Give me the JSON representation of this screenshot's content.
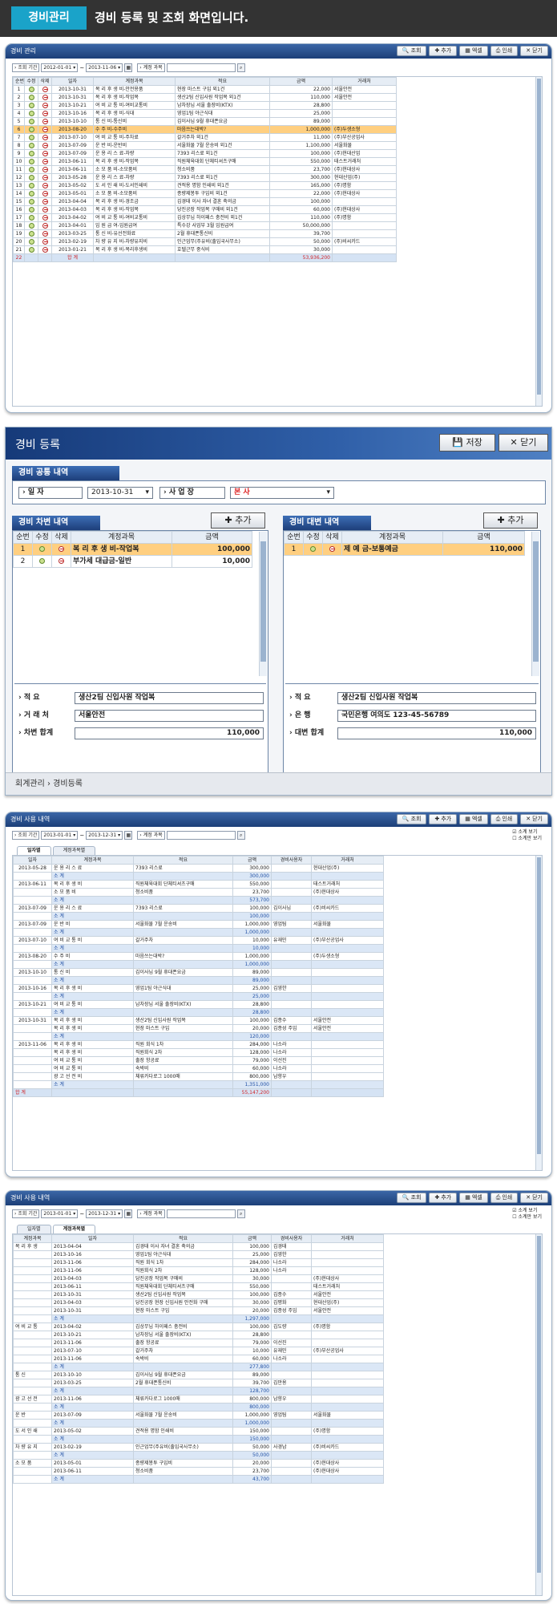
{
  "header": {
    "tag": "경비관리",
    "title": "경비 등록 및 조회 화면입니다."
  },
  "toolbar": {
    "search": "조회",
    "add": "추가",
    "excel": "엑셀",
    "print": "인쇄",
    "close": "닫기"
  },
  "filters": {
    "period_label": "조회 기간",
    "account_label": "계정 과목",
    "from": "2012-01-01",
    "to": "2013-11-06",
    "from2": "2013-01-01",
    "to2": "2013-12-31"
  },
  "panel1": {
    "title": "경비 관리",
    "columns": [
      "순번",
      "수정",
      "삭제",
      "일자",
      "계정과목",
      "적요",
      "금액",
      "거래처"
    ],
    "rows": [
      [
        "1",
        "2013-10-31",
        "복 리 후 생 비-안전용품",
        "현장 마스트 구입 외1건",
        "22,000",
        "서울안전"
      ],
      [
        "2",
        "2013-10-31",
        "복 리 후 생 비-작업복",
        "생산2팀 신입사원 작업복 외1건",
        "110,000",
        "서울안전"
      ],
      [
        "3",
        "2013-10-21",
        "여 비 교 통 비-여비교통비",
        "남차장님 서울 출장비(KTX)",
        "28,800",
        ""
      ],
      [
        "4",
        "2013-10-16",
        "복 리 후 생 비-식대",
        "영업1팀 야근식대",
        "25,000",
        ""
      ],
      [
        "5",
        "2013-10-10",
        "통 신 비-통신비",
        "김이사님 9월 휴대폰요금",
        "89,000",
        ""
      ],
      [
        "6",
        "2013-08-20",
        "수 주 비-수주비",
        "마음쓰는대박?",
        "1,000,000",
        "(주)두생소형"
      ],
      [
        "7",
        "2013-07-10",
        "여 비 교 통 비-주차료",
        "갈거주차 외1건",
        "11,000",
        "(주)부산공업사"
      ],
      [
        "8",
        "2013-07-09",
        "운 반 비-운반비",
        "서울화물 7월 운송비 외1건",
        "1,100,000",
        "서울화물"
      ],
      [
        "9",
        "2013-07-09",
        "운 용 리 스 료-차량",
        "7393 리스료 외1건",
        "100,000",
        "(주)현대산업"
      ],
      [
        "10",
        "2013-06-11",
        "복 리 후 생 비-작업복",
        "직원체육대회 단체티셔츠구매",
        "550,000",
        "태스트거래처"
      ],
      [
        "11",
        "2013-06-11",
        "소 모 품 비-소모품비",
        "청소비품",
        "23,700",
        "(주)현대상사"
      ],
      [
        "12",
        "2013-05-28",
        "운 용 리 스 료-차량",
        "7393 리스료 외1건",
        "300,000",
        "현대산업(주)"
      ],
      [
        "13",
        "2013-05-02",
        "도 서 인 쇄 비-도서인쇄비",
        "견적용 명함 인쇄비 외1건",
        "165,000",
        "(주)명함"
      ],
      [
        "14",
        "2013-05-01",
        "소 모 품 비-소모품비",
        "종량제봉투 구입비 외1건",
        "22,000",
        "(주)현대상사"
      ],
      [
        "15",
        "2013-04-04",
        "복 리 후 생 비-경조금",
        "김경태 이사 자녀 결혼 축의금",
        "100,000",
        ""
      ],
      [
        "16",
        "2013-04-03",
        "복 리 후 생 비-작업복",
        "당진공장 작업복 구매비 외1건",
        "60,000",
        "(주)현대상사"
      ],
      [
        "17",
        "2013-04-02",
        "여 비 교 통 비-여비교통비",
        "김상무님 하이패스 충전비 외1건",
        "110,000",
        "(주)명함"
      ],
      [
        "18",
        "2013-04-01",
        "임 원 급 여-임원급여",
        "특수강 사업부 3월 임원급여",
        "50,000,000",
        ""
      ],
      [
        "19",
        "2013-03-25",
        "통 신 비-유선전화료",
        "2월 휴대폰통신비",
        "39,700",
        ""
      ],
      [
        "20",
        "2013-02-19",
        "차 량 유 지 비-차량유지비",
        "인근업무(주유비(출입국사무소)",
        "50,000",
        "(주)비씨카드"
      ],
      [
        "21",
        "2013-01-21",
        "복 리 후 생 비-복리후생비",
        "호텔근무 중식비",
        "30,000",
        ""
      ]
    ],
    "total_no": "22",
    "total_label": "합 계",
    "total": "53,936,200"
  },
  "form": {
    "title": "경비 등록",
    "save": "저장",
    "close": "닫기",
    "common": "경비 공통 내역",
    "date_label": "일 자",
    "date": "2013-10-31",
    "site_label": "사 업 장",
    "site": "본 사",
    "debit_title": "경비 차변 내역",
    "credit_title": "경비 대변 내역",
    "add": "추가",
    "cols": [
      "순번",
      "수정",
      "삭제",
      "계정과목",
      "금액"
    ],
    "debit_rows": [
      [
        "1",
        "복 리 후 생 비-작업복",
        "100,000"
      ],
      [
        "2",
        "부가세 대급금-일반",
        "10,000"
      ]
    ],
    "credit_rows": [
      [
        "1",
        "제 예 금-보통예금",
        "110,000"
      ]
    ],
    "memo_label": "적 요",
    "memo": "생산2팀 신입사원 작업복",
    "vendor_label": "거 래 처",
    "vendor": "서울안전",
    "debit_sum_label": "차변 합계",
    "debit_sum": "110,000",
    "bank_label": "은 행",
    "bank": "국민은행 여의도 123-45-56789",
    "credit_sum_label": "대변 합계",
    "credit_sum": "110,000",
    "breadcrumb": [
      "회계관리",
      "경비등록"
    ]
  },
  "panel3": {
    "title": "경비 사용 내역",
    "tabs": [
      "일자별",
      "계정과목별"
    ],
    "chk1": "소계 보기",
    "chk2": "소계만 보기",
    "cols": [
      "일자",
      "계정과목",
      "적요",
      "금액",
      "경비사용자",
      "거래처"
    ],
    "rows": [
      [
        "2013-05-28",
        "운 용 리 스 료",
        "7393 리스료",
        "300,000",
        "",
        "현대산업(주)"
      ],
      [
        "",
        "소 계",
        "",
        "300,000",
        "",
        ""
      ],
      [
        "2013-06-11",
        "복 리 후 생 비",
        "직원체육대회 단체티셔츠구매",
        "550,000",
        "",
        "태스트거래처"
      ],
      [
        "",
        "소 모 품 비",
        "청소비품",
        "23,700",
        "",
        "(주)현대상사"
      ],
      [
        "",
        "소 계",
        "",
        "573,700",
        "",
        ""
      ],
      [
        "2013-07-09",
        "운 용 리 스 료",
        "7393 리스료",
        "100,000",
        "김이사님",
        "(주)비씨카드"
      ],
      [
        "",
        "소 계",
        "",
        "100,000",
        "",
        ""
      ],
      [
        "2013-07-09",
        "운 반 비",
        "서울화물 7월 운송비",
        "1,000,000",
        "영업팀",
        "서울화물"
      ],
      [
        "",
        "소 계",
        "",
        "1,000,000",
        "",
        ""
      ],
      [
        "2013-07-10",
        "여 비 교 통 비",
        "갈거주차",
        "10,000",
        "유재민",
        "(주)부산공업사"
      ],
      [
        "",
        "소 계",
        "",
        "10,000",
        "",
        ""
      ],
      [
        "2013-08-20",
        "수 주 비",
        "마음쓰는대박?",
        "1,000,000",
        "",
        "(주)두생소형"
      ],
      [
        "",
        "소 계",
        "",
        "1,000,000",
        "",
        ""
      ],
      [
        "2013-10-10",
        "통 신 비",
        "김이사님 9월 휴대폰요금",
        "89,000",
        "",
        ""
      ],
      [
        "",
        "소 계",
        "",
        "89,000",
        "",
        ""
      ],
      [
        "2013-10-16",
        "복 리 후 생 비",
        "영업1팀 야근식대",
        "25,000",
        "김영한",
        ""
      ],
      [
        "",
        "소 계",
        "",
        "25,000",
        "",
        ""
      ],
      [
        "2013-10-21",
        "여 비 교 통 비",
        "남차장님 서울 출장비(KTX)",
        "28,800",
        "",
        ""
      ],
      [
        "",
        "소 계",
        "",
        "28,800",
        "",
        ""
      ],
      [
        "2013-10-31",
        "복 리 후 생 비",
        "생산2팀 신입사원 작업복",
        "100,000",
        "김종수",
        "서울안전"
      ],
      [
        "",
        "복 리 후 생 비",
        "현장 마스트 구입",
        "20,000",
        "김종성 주임",
        "서울안전"
      ],
      [
        "",
        "소 계",
        "",
        "120,000",
        "",
        ""
      ],
      [
        "2013-11-06",
        "복 리 후 생 비",
        "직원 회식 1차",
        "284,000",
        "나소라",
        ""
      ],
      [
        "",
        "복 리 후 생 비",
        "직원회식 2차",
        "128,000",
        "나소라",
        ""
      ],
      [
        "",
        "여 비 교 통 비",
        "출장 항공료",
        "79,000",
        "이선진",
        ""
      ],
      [
        "",
        "여 비 교 통 비",
        "숙박비",
        "60,000",
        "나소라",
        ""
      ],
      [
        "",
        "광 고 선 전 비",
        "체류카다로그 1000매",
        "800,000",
        "남향우",
        ""
      ],
      [
        "",
        "소 계",
        "",
        "1,351,000",
        "",
        ""
      ]
    ],
    "total_label": "합 계",
    "total": "55,147,200"
  },
  "panel4": {
    "rows": [
      [
        "복 리 후 생",
        "2013-04-04",
        "김경태 이사 자녀 결혼 축의금",
        "100,000",
        "김경태",
        ""
      ],
      [
        "",
        "2013-10-16",
        "영업1팀 야근식대",
        "25,000",
        "김영한",
        ""
      ],
      [
        "",
        "2013-11-06",
        "직원 회식 1차",
        "284,000",
        "나소라",
        ""
      ],
      [
        "",
        "2013-11-06",
        "직원회식 2차",
        "128,000",
        "나소라",
        ""
      ],
      [
        "",
        "2013-04-03",
        "당진공장 작업복 구매비",
        "30,000",
        "",
        "(주)현대상사"
      ],
      [
        "",
        "2013-06-11",
        "직원체육대회 단체티셔츠구매",
        "550,000",
        "",
        "태스트거래처"
      ],
      [
        "",
        "2013-10-31",
        "생산2팀 신입사원 작업복",
        "100,000",
        "김종수",
        "서울안전"
      ],
      [
        "",
        "2013-04-03",
        "당진공장 현장 신입사원 안전화 구매",
        "30,000",
        "김평화",
        "현대산업(주)"
      ],
      [
        "",
        "2013-10-31",
        "현장 마스트 구입",
        "20,000",
        "김종성 주임",
        "서울안전"
      ],
      [
        "",
        "소 계",
        "",
        "1,297,000",
        "",
        ""
      ],
      [
        "여 비 교 통",
        "2013-04-02",
        "김상무님 하이패스 충전비",
        "100,000",
        "김도량",
        "(주)명함"
      ],
      [
        "",
        "2013-10-21",
        "남차장님 서울 출장비(KTX)",
        "28,800",
        "",
        ""
      ],
      [
        "",
        "2013-11-06",
        "출장 항공료",
        "79,000",
        "이선진",
        ""
      ],
      [
        "",
        "2013-07-10",
        "갈거주차",
        "10,000",
        "유재민",
        "(주)부산공업사"
      ],
      [
        "",
        "2013-11-06",
        "숙박비",
        "60,000",
        "나소라",
        ""
      ],
      [
        "",
        "소 계",
        "",
        "277,800",
        "",
        ""
      ],
      [
        "통 신",
        "2013-10-10",
        "김이사님 9월 휴대폰요금",
        "89,000",
        "",
        ""
      ],
      [
        "",
        "2013-03-25",
        "2월 휴대폰통신비",
        "39,700",
        "김만용",
        ""
      ],
      [
        "",
        "소 계",
        "",
        "128,700",
        "",
        ""
      ],
      [
        "광 고 선 전",
        "2013-11-06",
        "체류카다로그 1000매",
        "800,000",
        "남향우",
        ""
      ],
      [
        "",
        "소 계",
        "",
        "800,000",
        "",
        ""
      ],
      [
        "운 반",
        "2013-07-09",
        "서울화물 7월 운송비",
        "1,000,000",
        "영업팀",
        "서울화물"
      ],
      [
        "",
        "소 계",
        "",
        "1,000,000",
        "",
        ""
      ],
      [
        "도 서 인 쇄",
        "2013-05-02",
        "견적용 명함 인쇄비",
        "150,000",
        "",
        "(주)명함"
      ],
      [
        "",
        "소 계",
        "",
        "150,000",
        "",
        ""
      ],
      [
        "차 량 유 지",
        "2013-02-19",
        "인근업무(주유비(출입국사무소)",
        "50,000",
        "사경남",
        "(주)비씨카드"
      ],
      [
        "",
        "소 계",
        "",
        "50,000",
        "",
        ""
      ],
      [
        "소 모 품",
        "2013-05-01",
        "종량제봉투 구입비",
        "20,000",
        "",
        "(주)현대상사"
      ],
      [
        "",
        "2013-06-11",
        "청소비품",
        "23,700",
        "",
        "(주)현대상사"
      ],
      [
        "",
        "소 계",
        "",
        "43,700",
        "",
        ""
      ]
    ]
  },
  "colors": {
    "accent": "#1aa3c9",
    "titlebar": "#1c3f78",
    "highlight": "#ffcf80",
    "subtotal": "#dbe7f6",
    "total_red": "#d0252a"
  }
}
